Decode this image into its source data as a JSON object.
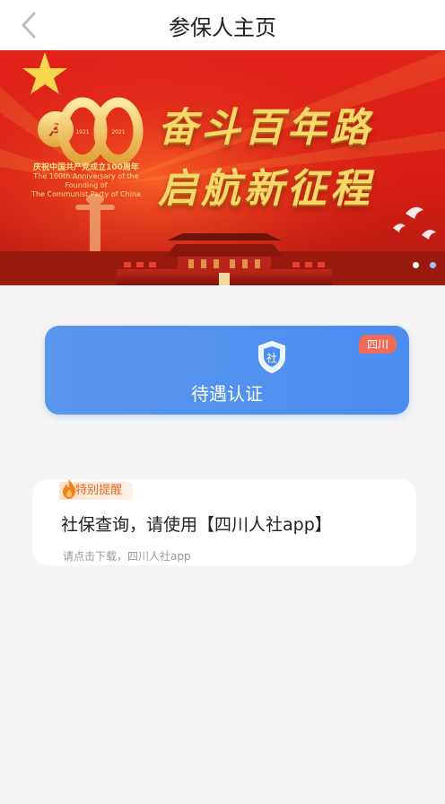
{
  "header": {
    "title": "参保人主页",
    "back_icon": "chevron-left-icon"
  },
  "banner": {
    "slogan_line1": "奋斗百年路",
    "slogan_line2": "启航新征程",
    "emblem": {
      "number": "100",
      "year_left": "1921",
      "year_right": "2021",
      "caption_cn": "庆祝中国共产党成立100周年",
      "caption_en_1": "The 100th Anniversary of the Founding of",
      "caption_en_2": "The Communist Party of China"
    },
    "carousel_pages": 2,
    "active_page": 1,
    "colors": {
      "background": "#d81e14",
      "gold": "#f9d86a"
    }
  },
  "service": {
    "label": "待遇认证",
    "badge": "四川",
    "icon_text": "社",
    "colors": {
      "card": "#4a8cf0",
      "badge": "#f06a5a"
    }
  },
  "notice": {
    "tag": "特别提醒",
    "text": "社保查询，请使用【四川人社app】",
    "subtext": "请点击下载，四川人社app",
    "icon": "flame-icon"
  }
}
